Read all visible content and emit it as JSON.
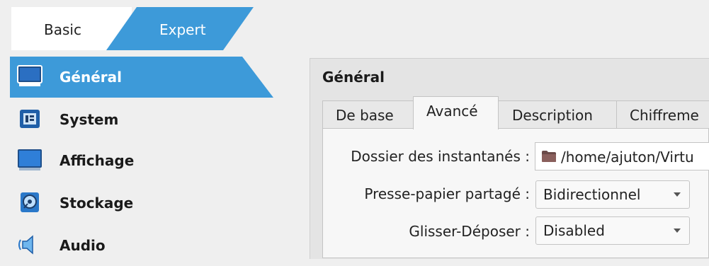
{
  "mode_tabs": {
    "basic": "Basic",
    "expert": "Expert"
  },
  "sidebar": {
    "items": [
      {
        "label": "Général",
        "icon": "monitor-icon",
        "selected": true
      },
      {
        "label": "System",
        "icon": "chip-icon",
        "selected": false
      },
      {
        "label": "Affichage",
        "icon": "display-icon",
        "selected": false
      },
      {
        "label": "Stockage",
        "icon": "storage-disk-icon",
        "selected": false
      },
      {
        "label": "Audio",
        "icon": "speaker-icon",
        "selected": false
      }
    ]
  },
  "panel": {
    "title": "Général",
    "tabs": [
      {
        "label": "De base",
        "active": false
      },
      {
        "label": "Avancé",
        "active": true
      },
      {
        "label": "Description",
        "active": false
      },
      {
        "label": "Chiffreme",
        "active": false
      }
    ],
    "fields": {
      "snapshot_folder": {
        "label": "Dossier des instantanés :",
        "value": "/home/ajuton/Virtu"
      },
      "clipboard": {
        "label": "Presse-papier partagé :",
        "value": "Bidirectionnel"
      },
      "drag_drop": {
        "label": "Glisser-Déposer :",
        "value": "Disabled"
      }
    }
  },
  "colors": {
    "accent": "#3d9ad9",
    "panel_bg": "#e4e4e4",
    "content_bg": "#f7f7f7"
  }
}
